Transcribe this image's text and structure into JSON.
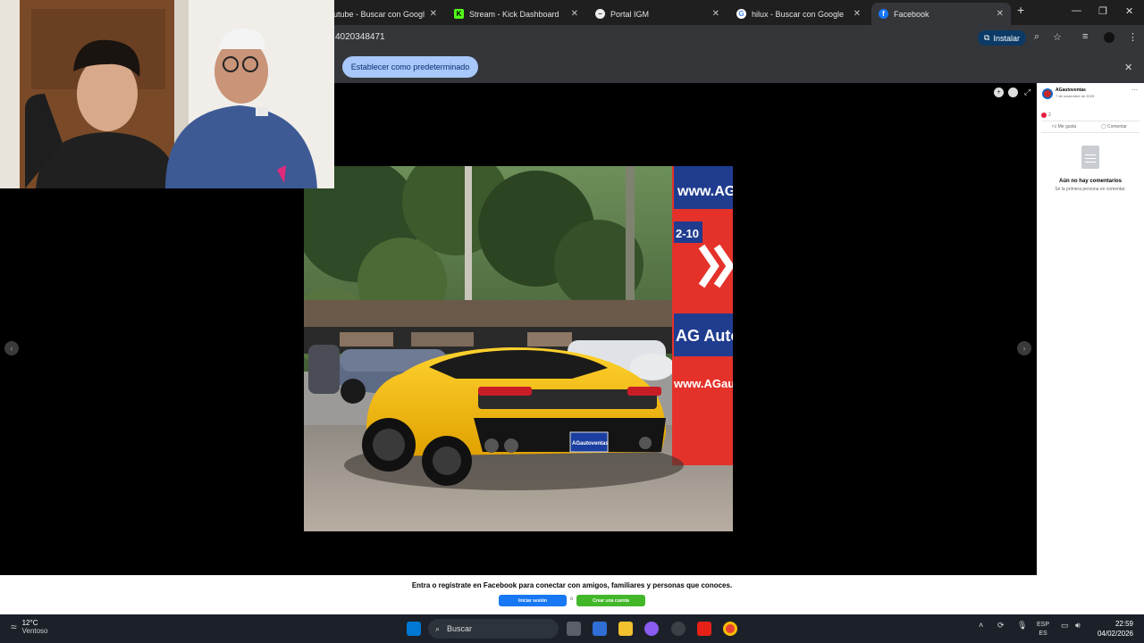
{
  "browser": {
    "tabs": [
      {
        "label": "utube - Buscar con Google",
        "favicon": "google-icon"
      },
      {
        "label": "Stream - Kick Dashboard",
        "favicon": "kick-icon"
      },
      {
        "label": "Portal IGM",
        "favicon": "globe-icon"
      },
      {
        "label": "hilux - Buscar con Google",
        "favicon": "google-icon"
      },
      {
        "label": "Facebook",
        "favicon": "facebook-icon"
      }
    ],
    "active_tab_index": 4,
    "url": "4020348471",
    "install_label": "Instalar",
    "infobar_button": "Establecer como predeterminado"
  },
  "post": {
    "page_name": "AGautoventas",
    "date": "7 de noviembre de 2025 · ",
    "reactions_count": "2",
    "like_label": "Me gusta",
    "comment_label": "Comentar",
    "no_comments_title": "Aún no hay comentarios",
    "no_comments_sub": "Sé la primera persona en comentar."
  },
  "photo_scene": {
    "plate_text": "AGautoventas",
    "sign_top": "www.AG",
    "sign_arrow_text": "2-10",
    "sign_brand": "AG Auto",
    "sign_url": "www.AGaut"
  },
  "login_banner": {
    "message": "Entra o regístrate en Facebook para conectar con amigos, familiares y personas que conoces.",
    "login_label": "Iniciar sesión",
    "separator": "o",
    "signup_label": "Crear una cuenta"
  },
  "taskbar": {
    "temperature": "12°C",
    "weather": "Ventoso",
    "search_placeholder": "Buscar",
    "lang_top": "ESP",
    "lang_bottom": "ES",
    "time": "22:59",
    "date": "04/02/2026"
  },
  "colors": {
    "fb_blue": "#1877f2",
    "fb_green": "#42b72a",
    "car_yellow": "#f2b705",
    "sign_red": "#e4322b"
  }
}
